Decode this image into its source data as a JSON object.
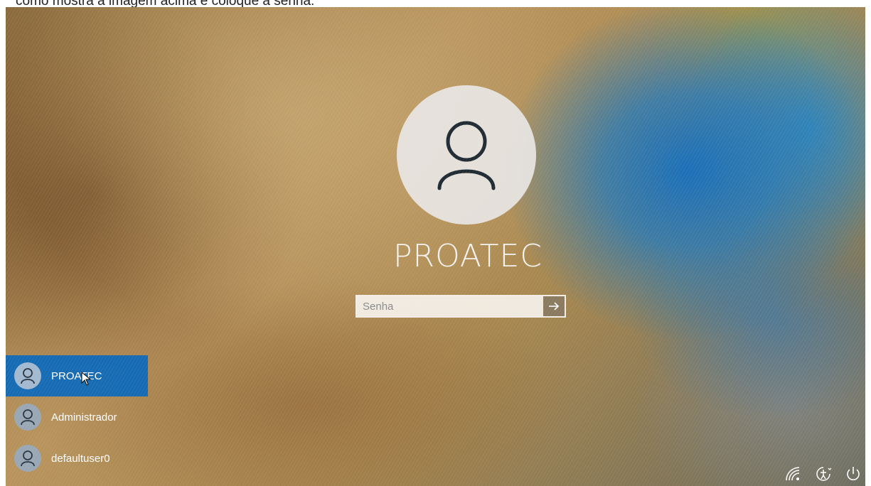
{
  "caption": {
    "text": "como mostra a imagem acima e coloque a senha."
  },
  "login": {
    "username": "PROATEC",
    "password_placeholder": "Senha",
    "password_value": "",
    "submit_icon": "arrow-right-icon"
  },
  "users": [
    {
      "name": "PROATEC",
      "icon": "user-icon",
      "selected": true
    },
    {
      "name": "Administrador",
      "icon": "user-icon",
      "selected": false
    },
    {
      "name": "defaultuser0",
      "icon": "user-icon",
      "selected": false
    }
  ],
  "tray": [
    {
      "name": "network-icon"
    },
    {
      "name": "accessibility-icon"
    },
    {
      "name": "power-icon"
    }
  ],
  "colors": {
    "selected_user_bg": "#0067C0",
    "text": "#FFFFFF"
  }
}
